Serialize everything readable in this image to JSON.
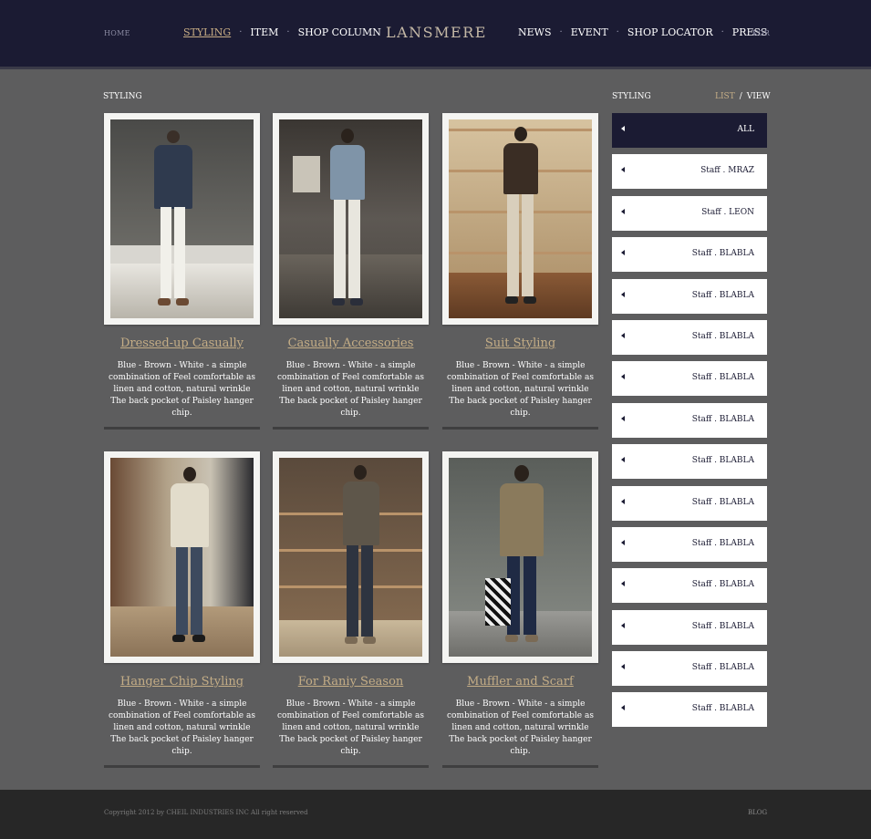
{
  "header": {
    "home": "HOME",
    "nav_left": [
      "STYLING",
      "ITEM",
      "SHOP COLUMN"
    ],
    "logo": "LANSMERE",
    "nav_right": [
      "NEWS",
      "EVENT",
      "SHOP LOCATOR",
      "PRESS"
    ],
    "lang": "KOR"
  },
  "main": {
    "section_title": "STYLING",
    "cards": [
      {
        "title": "Dressed-up Casually",
        "desc": "Blue - Brown - White - a simple combination of Feel comfortable as linen and cotton, natural wrinkle The back pocket of Paisley hanger chip."
      },
      {
        "title": "Casually Accessories",
        "desc": "Blue - Brown - White - a simple combination of Feel comfortable as linen and cotton, natural wrinkle The back pocket of Paisley hanger chip."
      },
      {
        "title": "Suit Styling",
        "desc": "Blue - Brown - White - a simple combination of Feel comfortable as linen and cotton, natural wrinkle The back pocket of Paisley hanger chip."
      },
      {
        "title": "Hanger Chip Styling",
        "desc": "Blue - Brown - White - a simple combination of Feel comfortable as linen and cotton, natural wrinkle The back pocket of Paisley hanger chip."
      },
      {
        "title": "For Raniy Season",
        "desc": "Blue - Brown - White - a simple combination of Feel comfortable as linen and cotton, natural wrinkle The back pocket of Paisley hanger chip."
      },
      {
        "title": "Muffler and Scarf",
        "desc": "Blue - Brown - White - a simple combination of Feel comfortable as linen and cotton, natural wrinkle The back pocket of Paisley hanger chip."
      }
    ]
  },
  "sidebar": {
    "title": "STYLING",
    "toggle_list": "LIST",
    "toggle_sep": "/",
    "toggle_view": "VIEW",
    "items": [
      "ALL",
      "Staff . MRAZ",
      "Staff . LEON",
      "Staff . BLABLA",
      "Staff . BLABLA",
      "Staff . BLABLA",
      "Staff . BLABLA",
      "Staff . BLABLA",
      "Staff . BLABLA",
      "Staff . BLABLA",
      "Staff . BLABLA",
      "Staff . BLABLA",
      "Staff . BLABLA",
      "Staff . BLABLA",
      "Staff . BLABLA"
    ]
  },
  "footer": {
    "copyright": "Copyright 2012 by CHEIL INDUSTRIES INC All right reserved",
    "blog": "BLOG"
  },
  "colors": {
    "navy": "#1b1b33",
    "accent_gold": "#c4ad86",
    "background": "#5d5d5e"
  }
}
